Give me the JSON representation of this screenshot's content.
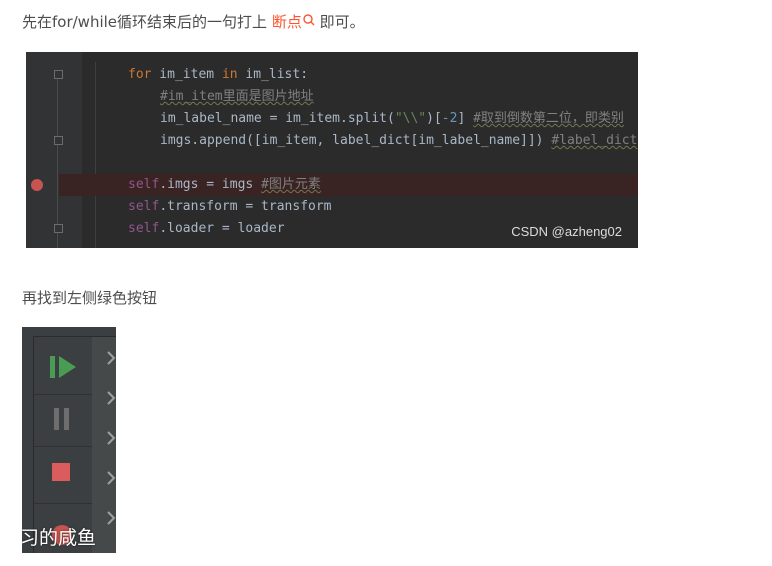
{
  "paragraph1": {
    "before": "先在for/while循环结束后的一句打上",
    "link": "断点",
    "after": "即可。"
  },
  "code": {
    "line1": {
      "kw1": "for",
      "a": " im_item ",
      "kw2": "in",
      "b": " im_list:"
    },
    "line2": {
      "comment": "#im_item里面是图片地址"
    },
    "line3": {
      "a": "im_label_name = im_item.split(",
      "str": "\"\\\\\"",
      "b": ")[",
      "num": "-2",
      "c": "]",
      "comment": "#取到倒数第二位，即类别"
    },
    "line4": {
      "a": "imgs.append([im_item, label_dict[im_label_name]])",
      "comment": "#label_dict"
    },
    "line5": {
      "self": "self",
      "a": ".imgs = imgs ",
      "comment": "#图片元素"
    },
    "line6": {
      "self": "self",
      "a": ".transform = transform"
    },
    "line7": {
      "self": "self",
      "a": ".loader = loader"
    },
    "watermark": "CSDN @azheng02"
  },
  "paragraph2": "再找到左侧绿色按钮",
  "panel": {
    "overlay_text": "习的咸鱼",
    "icons": [
      "resume-icon",
      "pause-icon",
      "stop-icon"
    ]
  },
  "colors": {
    "link": "#fc5531",
    "resume": "#499c54",
    "stop": "#db5c5c",
    "breakpoint": "#c75450"
  }
}
